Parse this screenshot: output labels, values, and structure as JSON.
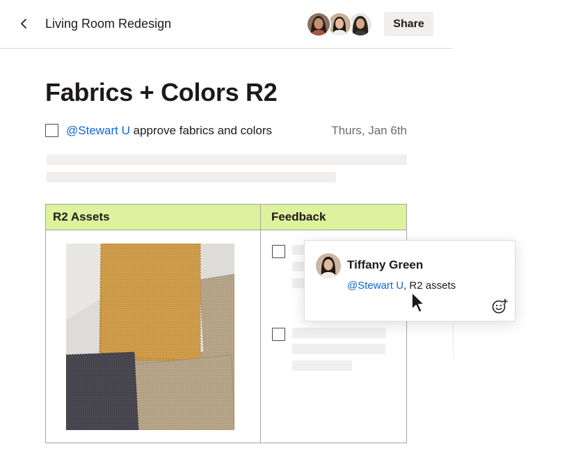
{
  "header": {
    "back_icon": "chevron-left-icon",
    "doc_title": "Living Room Redesign",
    "share_label": "Share",
    "collaborators": [
      "collaborator-1",
      "collaborator-2",
      "collaborator-3"
    ]
  },
  "doc": {
    "title": "Fabrics + Colors R2",
    "task": {
      "checked": false,
      "mention": "@Stewart U",
      "text": " approve fabrics and colors",
      "date": "Thurs, Jan 6th"
    }
  },
  "table": {
    "headers": [
      "R2 Assets",
      "Feedback"
    ],
    "header_color": "#ddf29c",
    "asset_image": "fabric-swatches",
    "feedback_items": [
      {
        "checked": false
      },
      {
        "checked": false
      }
    ]
  },
  "comment": {
    "author": "Tiffany Green",
    "mention": "@Stewart U",
    "text": ", R2 assets",
    "reaction_icon": "add-emoji-icon"
  },
  "colors": {
    "mention": "#0e66d4",
    "text": "#1e1919",
    "muted": "#6f6a66",
    "skeleton": "#f1efed"
  }
}
